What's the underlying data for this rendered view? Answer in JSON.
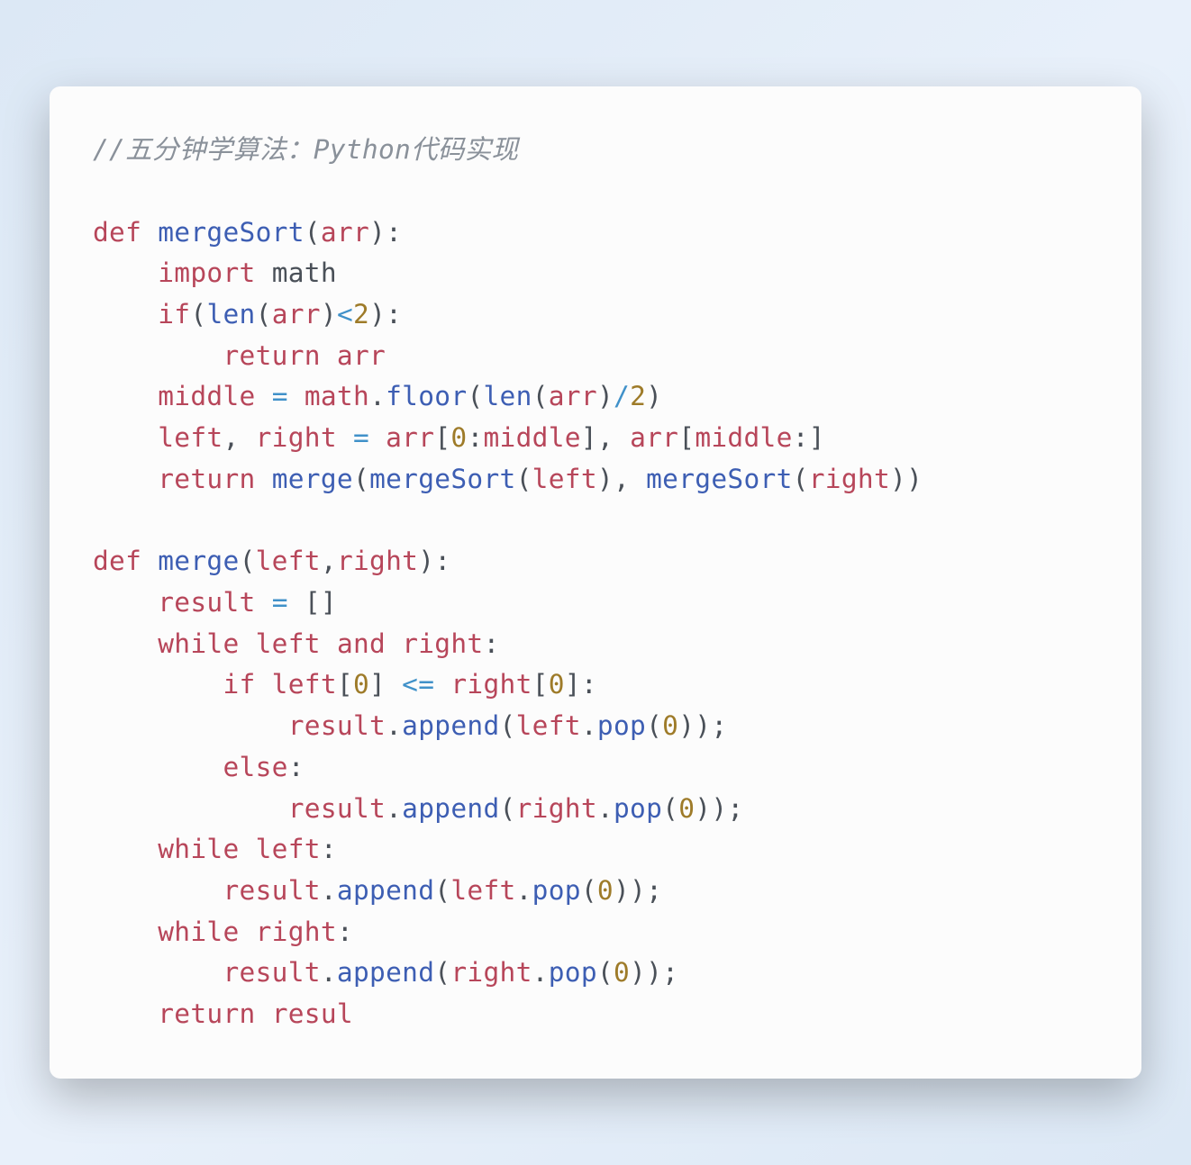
{
  "code": {
    "comment": "//五分钟学算法：Python代码实现",
    "tokens": {
      "def": "def",
      "mergeSort": "mergeSort",
      "merge": "merge",
      "arr": "arr",
      "left": "left",
      "right": "right",
      "import": "import",
      "math": "math",
      "if": "if",
      "len": "len",
      "two": "2",
      "return": "return",
      "middle": "middle",
      "floor": "floor",
      "zero": "0",
      "result": "result",
      "resul": "resul",
      "while": "while",
      "and": "and",
      "else": "else",
      "append": "append",
      "pop": "pop",
      "eq": "=",
      "lt": "<",
      "lte": "<=",
      "div": "/",
      "lparen": "(",
      "rparen": ")",
      "lbrack": "[",
      "rbrack": "]",
      "colon": ":",
      "comma": ",",
      "dot": ".",
      "semi": ";"
    }
  }
}
